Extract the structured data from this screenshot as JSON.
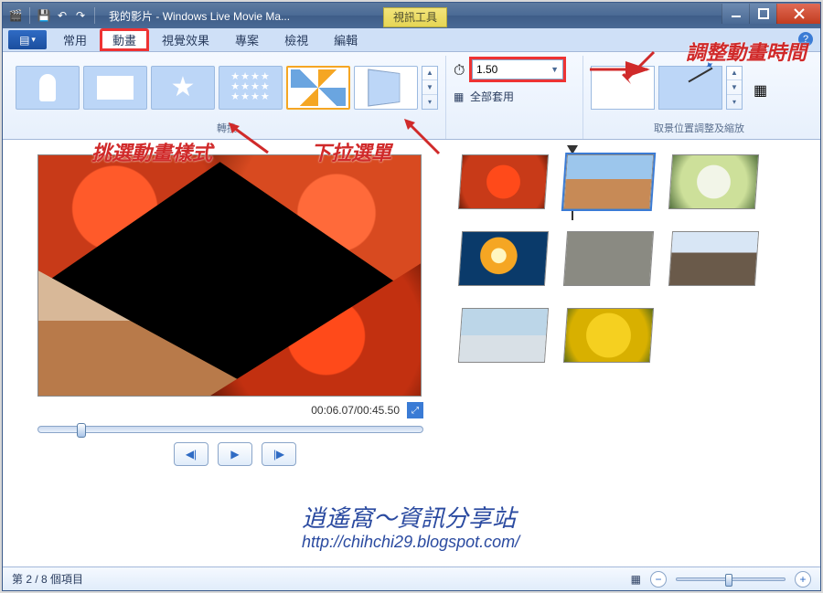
{
  "titlebar": {
    "doc_title": "我的影片",
    "app_title": "Windows Live Movie Ma...",
    "context_tab": "視訊工具"
  },
  "tabs": {
    "file": "▾",
    "home": "常用",
    "animations": "動畫",
    "visual_effects": "視覺效果",
    "project": "專案",
    "view": "檢視",
    "edit": "編輯"
  },
  "ribbon": {
    "transitions_label": "轉換",
    "duration_value": "1.50",
    "apply_all": "全部套用",
    "panzoom_label": "取景位置調整及縮放"
  },
  "preview": {
    "time_current": "00:06.07",
    "time_total": "00:45.50"
  },
  "status": {
    "item_counter": "第 2 / 8 個項目"
  },
  "annotations": {
    "adjust_duration": "調整動畫時間",
    "pick_style": "挑選動畫樣式",
    "pulldown": "下拉選單"
  },
  "watermark": {
    "line1": "逍遙窩～資訊分享站",
    "line2": "http://chihchi29.blogspot.com/"
  }
}
